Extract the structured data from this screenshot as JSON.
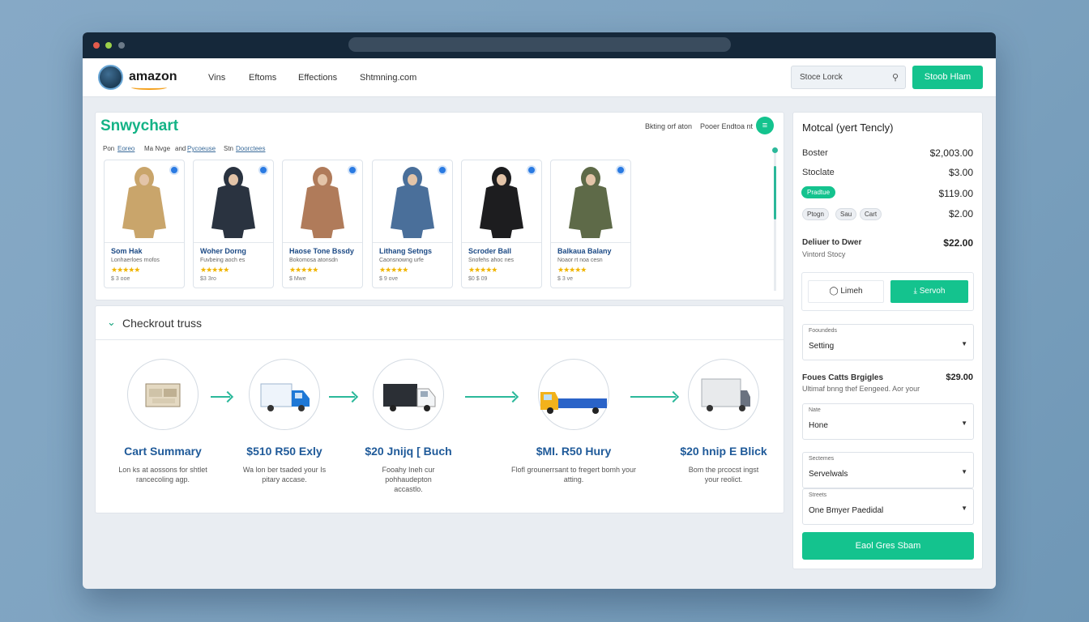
{
  "nav": {
    "logo_text": "amazon",
    "links": [
      "Vins",
      "Eftoms",
      "Effections",
      "Shtmning.com"
    ],
    "search_placeholder": "Stoce Lorck",
    "button_label": "Stoob Hlam"
  },
  "products": {
    "brand_title": "Snwychart",
    "header_text": "Bkting orf aton",
    "header_text2": "Pooer Endtoa nt",
    "filters": [
      "Pon",
      "Eoreo",
      "Ma Nvge",
      "and",
      "Pycoeuse",
      "Stn",
      "Doorctees"
    ],
    "items": [
      {
        "name": "Som Hak",
        "desc": "Lonhaerloes rnofos",
        "stars": "★★★★★",
        "price": "$ 3 ooe",
        "color": "#c9a56b"
      },
      {
        "name": "Woher Dorng",
        "desc": "Fuvbeing aoch es",
        "stars": "★★★★★",
        "price": "$3 3ro",
        "color": "#2a3340"
      },
      {
        "name": "Haose Tone Bssdy",
        "desc": "Bokomosa atonsdn",
        "stars": "★★★★★",
        "price": "$ Mwe",
        "color": "#b07b5a"
      },
      {
        "name": "Lithang Setngs",
        "desc": "Caonsnowng urfe",
        "stars": "★★★★★",
        "price": "$ 9 ove",
        "color": "#4a6f9a"
      },
      {
        "name": "Scroder Ball",
        "desc": "Snofehs ahoc nes",
        "stars": "★★★★★",
        "price": "$0 $ 09",
        "color": "#1d1d1f"
      },
      {
        "name": "Balkaua Balany",
        "desc": "Noaor rt noa cesn",
        "stars": "★★★★★",
        "price": "$ 3 ve",
        "color": "#5e6a48"
      }
    ]
  },
  "checkout": {
    "title": "Checkrout truss",
    "steps": [
      {
        "title": "Cart Summary",
        "desc": "Lon ks at aossons for shtlet rancecoling agp.",
        "icon": "boxes-icon"
      },
      {
        "title": "$510 R50 Exly",
        "desc": "Wa lon ber tsaded your Is pitary accase.",
        "icon": "truck-icon"
      },
      {
        "title": "$20 Jnijq [ Buch",
        "desc": "Fooahy Ineh cur pohhaudepton accastlo.",
        "icon": "delivery-van-icon"
      },
      {
        "title": "$MI. R50 Hury",
        "desc": "Flofl grounerrsant to fregert bomh your atting.",
        "icon": "pickup-truck-icon"
      },
      {
        "title": "$20 hnip E Blick",
        "desc": "Bom the prcocst ingst your reolict.",
        "icon": "cargo-truck-icon"
      }
    ]
  },
  "summary": {
    "title": "Motcal (yert Tencly)",
    "rows": [
      {
        "label": "Boster",
        "value": "$2,003.00"
      },
      {
        "label": "Stoclate",
        "value": "$3.00"
      },
      {
        "label": "",
        "value": "$119.00"
      },
      {
        "label": "",
        "value": "$2.00"
      }
    ],
    "pill_green": "Pradtue",
    "pills": [
      "Ptogn",
      "Sau",
      "Cart"
    ],
    "deliver_label": "Deliuer to Dwer",
    "deliver_value": "$22.00",
    "deliver_sub": "Vintord Stocy",
    "outline_btn": "Limeh",
    "fill_btn": "Servoh",
    "select1": {
      "label": "Fooundeds",
      "value": "Setting"
    },
    "fees_label": "Foues Catts Brgigles",
    "fees_value": "$29.00",
    "fees_sub": "Ultimaf bnng thef Eengeed. Aor your",
    "select2": {
      "label": "Nate",
      "value": "Hone"
    },
    "select3": {
      "label": "Sectemes",
      "value": "Servelwals"
    },
    "select4": {
      "label": "Streets",
      "value": "One Bmyer Paedidal"
    },
    "bottom_btn": "Eaol Gres Sbam"
  },
  "colors": {
    "accent": "#14c38e",
    "brand_text": "#14b386",
    "link_blue": "#1f5a99",
    "titlebar": "#15283a"
  }
}
